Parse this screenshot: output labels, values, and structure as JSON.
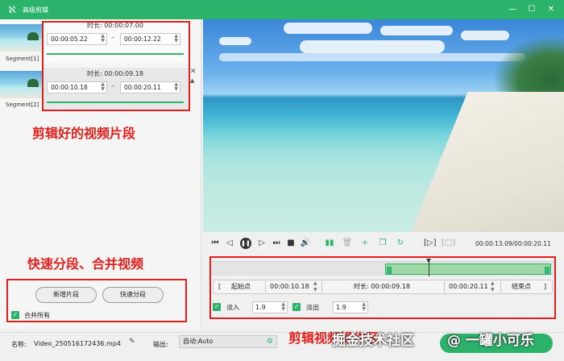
{
  "app": {
    "title": "高级剪辑"
  },
  "segments": [
    {
      "label": "Segment[1]",
      "duration_label": "时长:",
      "duration": "00:00:07.00",
      "start": "00:00:05.22",
      "end": "00:00:12.22"
    },
    {
      "label": "Segment[2]",
      "duration_label": "时长:",
      "duration": "00:00:09.18",
      "start": "00:00:10.18",
      "end": "00:00:20.11"
    }
  ],
  "annotations": {
    "segments": "剪辑好的视频片段",
    "split_merge": "快速分段、合并视频",
    "trim_area": "剪辑视频操作区"
  },
  "left_actions": {
    "add_segment": "新增片段",
    "quick_split": "快速分段",
    "merge_all": "合并所有",
    "merge_checked": true
  },
  "player": {
    "time": "00:00:13.09/00:00:20.11"
  },
  "trim": {
    "start_label": "起始点",
    "start": "00:00:10.18",
    "duration_label": "时长:",
    "duration": "00:00:09.18",
    "end": "00:00:20.11",
    "end_label": "结束点",
    "playhead_fraction": 0.26
  },
  "fade": {
    "in_label": "淡入",
    "in_value": "1.9",
    "out_label": "淡出",
    "out_value": "1.9",
    "in_checked": true,
    "out_checked": true
  },
  "bottom": {
    "name_label": "名称:",
    "filename": "Video_250516172436.mp4",
    "output_label": "输出:",
    "output_value": "自动:Auto"
  },
  "watermark": {
    "left": "掘金技术社区",
    "right": "@ 一罐小可乐"
  },
  "colors": {
    "brand": "#2bb36b",
    "annotation": "#e0201c"
  }
}
